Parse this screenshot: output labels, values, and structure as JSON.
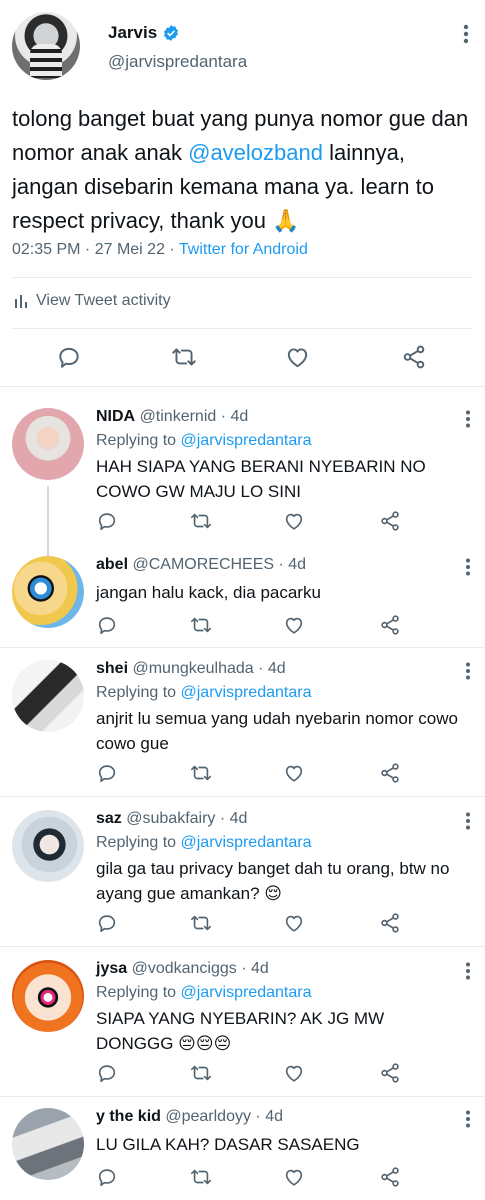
{
  "tweet": {
    "author_name": "Jarvis",
    "author_handle": "@jarvispredantara",
    "text_before": "tolong banget buat yang punya nomor gue dan nomor anak anak ",
    "mention": "@avelozband",
    "text_after": " lainnya, jangan disebarin kemana mana ya. learn to respect privacy, thank you 🙏",
    "time": "02:35 PM",
    "dot": " · ",
    "date": "27 Mei 22",
    "source": "Twitter for Android",
    "view_activity": "View Tweet activity"
  },
  "replies": [
    {
      "name": "NIDA",
      "handle": "@tinkernid",
      "age": " · 4d",
      "replying_label": "Replying to ",
      "replying_to": "@jarvispredantara",
      "text": "HAH SIAPA YANG BERANI NYEBARIN NO COWO GW MAJU LO SINI"
    },
    {
      "name": "abel",
      "handle": "@CAMORECHEES",
      "age": " · 4d",
      "text": "jangan halu kack, dia pacarku"
    },
    {
      "name": "shei",
      "handle": "@mungkeulhada",
      "age": " · 4d",
      "replying_label": "Replying to ",
      "replying_to": "@jarvispredantara",
      "text": "anjrit lu semua yang udah nyebarin nomor cowo cowo gue"
    },
    {
      "name": "saz",
      "handle": "@subakfairy",
      "age": " · 4d",
      "replying_label": "Replying to ",
      "replying_to": "@jarvispredantara",
      "text": "gila ga tau privacy banget dah tu orang, btw no ayang gue amankan? 😌"
    },
    {
      "name": "jysa",
      "handle": "@vodkanciggs",
      "age": " · 4d",
      "replying_label": "Replying to ",
      "replying_to": "@jarvispredantara",
      "text": "SIAPA YANG NYEBARIN? AK JG MW DONGGG 😔😔😔"
    },
    {
      "name": "y the kid",
      "handle": "@pearldoyy",
      "age": " · 4d",
      "text": "LU GILA KAH? DASAR SASAENG"
    }
  ],
  "colors": {
    "accent": "#1d9bf0",
    "text": "#0f1419",
    "muted": "#536471",
    "icon": "#536471",
    "border": "#e6ecf0"
  },
  "icons": [
    "verified-badge-icon",
    "more-vertical-icon",
    "bar-chart-icon",
    "reply-icon",
    "retweet-icon",
    "like-icon",
    "share-icon"
  ]
}
